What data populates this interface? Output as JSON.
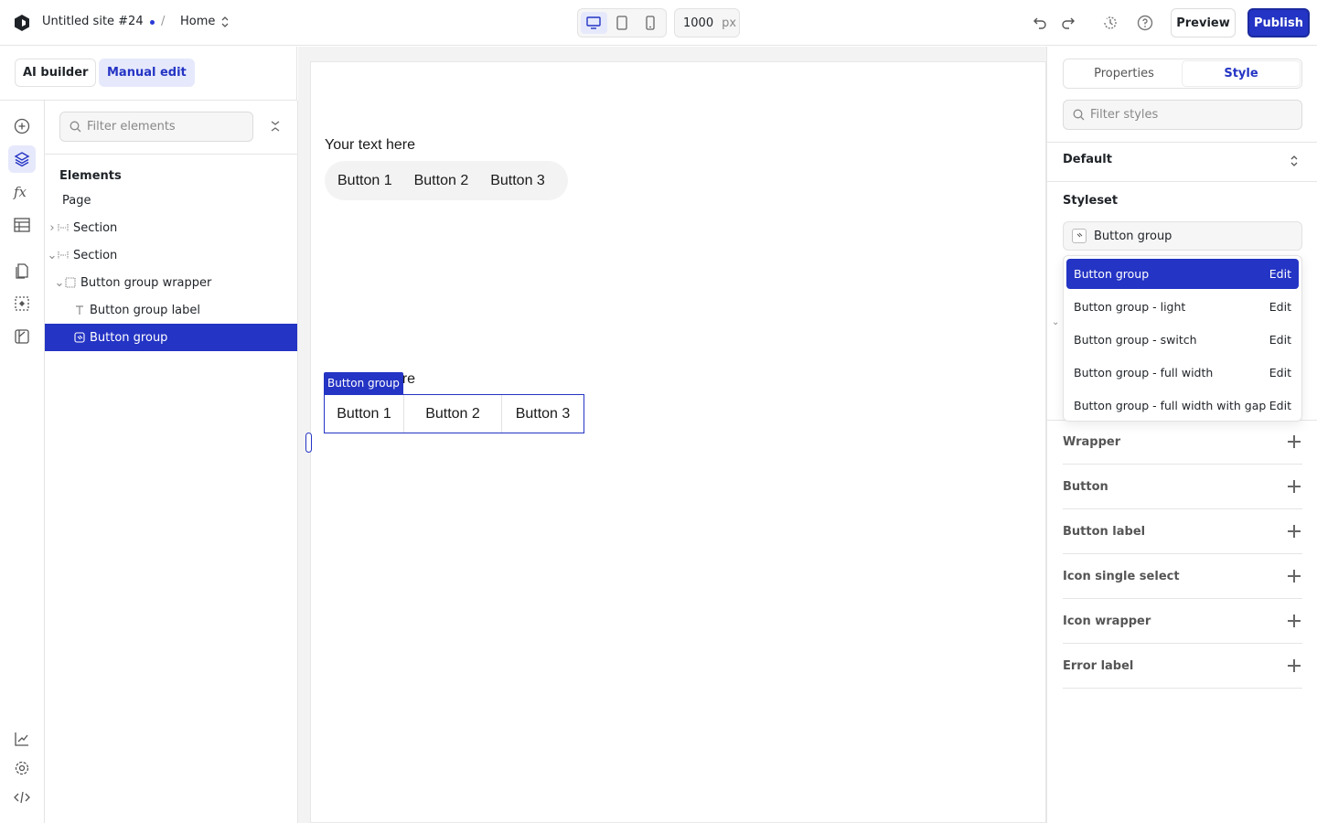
{
  "header": {
    "site_title": "Untitled site #24",
    "breadcrumb_sep": "/",
    "page_name": "Home",
    "width_value": "1000",
    "width_unit": "px",
    "preview_label": "Preview",
    "publish_label": "Publish"
  },
  "mode": {
    "ai_builder": "AI builder",
    "manual_edit": "Manual edit"
  },
  "elements_panel": {
    "filter_placeholder": "Filter elements",
    "heading": "Elements",
    "tree": [
      {
        "label": "Page"
      },
      {
        "label": "Section"
      },
      {
        "label": "Section"
      },
      {
        "label": "Button group wrapper"
      },
      {
        "label": "Button group label"
      },
      {
        "label": "Button group"
      }
    ]
  },
  "canvas": {
    "text1": "Your text here",
    "pill_buttons": [
      "Button 1",
      "Button 2",
      "Button 3"
    ],
    "text2_visible": "ere",
    "selection_tag": "Button group",
    "seg_buttons": [
      "Button 1",
      "Button 2",
      "Button 3"
    ]
  },
  "right_panel": {
    "tabs": [
      "Properties",
      "Style"
    ],
    "filter_placeholder": "Filter styles",
    "state_label": "Default",
    "styleset_heading": "Styleset",
    "styleset_value": "Button group",
    "dropdown": [
      {
        "label": "Button group",
        "action": "Edit"
      },
      {
        "label": "Button group - light",
        "action": "Edit"
      },
      {
        "label": "Button group - switch",
        "action": "Edit"
      },
      {
        "label": "Button group - full width",
        "action": "Edit"
      },
      {
        "label": "Button group - full width with gap",
        "action": "Edit"
      }
    ],
    "sections": [
      "Wrapper",
      "Button",
      "Button label",
      "Icon single select",
      "Icon wrapper",
      "Error label"
    ]
  },
  "colors": {
    "accent": "#2434c4",
    "accent_light": "#e6e9fb"
  }
}
